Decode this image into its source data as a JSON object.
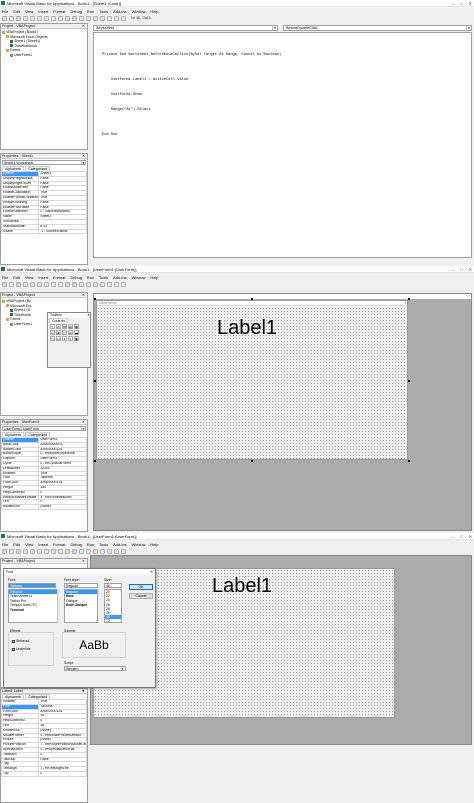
{
  "app_title": "Microsoft Visual Basic for Applications",
  "window1": {
    "title": "Microsoft Visual Basic for Applications - Book1 - [Sheet1 (Code)]",
    "menu": [
      "File",
      "Edit",
      "View",
      "Insert",
      "Format",
      "Debug",
      "Run",
      "Tools",
      "Add-Ins",
      "Window",
      "Help"
    ],
    "position": "Ln 10, Col 1",
    "project_title": "Project - VBAProject",
    "tree": [
      "VBAProject (Book1)",
      "Microsoft Excel Objects",
      "Sheet1 (Sheet1)",
      "ThisWorkbook",
      "Forms",
      "UserForm1"
    ],
    "props_title": "Properties - Sheet1",
    "props_combo": "Sheet1 Worksheet",
    "tabs": [
      "Alphabetic",
      "Categorized"
    ],
    "props": [
      [
        "(Name)",
        "Sheet1"
      ],
      [
        "DisplayPageBreaks",
        "False"
      ],
      [
        "DisplayRightToLeft",
        "False"
      ],
      [
        "EnableAutoFilter",
        "False"
      ],
      [
        "EnableCalculation",
        "True"
      ],
      [
        "EnableFormatConditionsCalculation",
        "True"
      ],
      [
        "EnableOutlining",
        "False"
      ],
      [
        "EnablePivotTable",
        "False"
      ],
      [
        "EnableSelection",
        "0 - xlNoRestrictions"
      ],
      [
        "Name",
        "Sheet1"
      ],
      [
        "ScrollArea",
        ""
      ],
      [
        "StandardWidth",
        "8.43"
      ],
      [
        "Visible",
        "-1 - xlSheetVisible"
      ]
    ],
    "object_combo": "Worksheet",
    "proc_combo": "BeforeDoubleClick",
    "code": [
      "Private Sub Worksheet_BeforeDoubleClick(ByVal Target As Range, Cancel As Boolean)",
      "",
      "    UserForm1.Label1 = ActiveCell.Value",
      "    UserForm1.Show",
      "    Range(\"A1\").Select",
      "",
      "End Sub"
    ]
  },
  "window2": {
    "title": "Microsoft Visual Basic for Applications - Book1 - [UserForm1 (UserForm)]",
    "menu": [
      "File",
      "Edit",
      "View",
      "Insert",
      "Format",
      "Debug",
      "Run",
      "Tools",
      "Add-Ins",
      "Window",
      "Help"
    ],
    "project_title": "Project - VBAProject",
    "tree": [
      "VBAProject (Bo",
      "Microsoft Exc",
      "Sheet1 (S",
      "ThisWorkb",
      "Forms",
      "UserForm1"
    ],
    "toolbox_title": "Toolbox",
    "toolbox_tab": "Controls",
    "form_caption": "UserForm1",
    "label_text": "Label1",
    "props_title": "Properties - UserForm1",
    "props_combo": "UserForm1 UserForm",
    "tabs": [
      "Alphabetic",
      "Categorized"
    ],
    "props": [
      [
        "(Name)",
        "UserForm1"
      ],
      [
        "BackColor",
        "&H8000000F&"
      ],
      [
        "BorderColor",
        "&H80000012&"
      ],
      [
        "BorderStyle",
        "0 - fmBorderStyleNone"
      ],
      [
        "Caption",
        "UserForm1"
      ],
      [
        "Cycle",
        "0 - fmCycleAllForms"
      ],
      [
        "DrawBuffer",
        "32000"
      ],
      [
        "Enabled",
        "True"
      ],
      [
        "Font",
        "Tahoma"
      ],
      [
        "ForeColor",
        "&H80000012&"
      ],
      [
        "Height",
        "180"
      ],
      [
        "HelpContextID",
        "0"
      ],
      [
        "KeepScrollBarsVisible",
        "3 - fmScrollBarsBoth"
      ],
      [
        "Left",
        "0"
      ],
      [
        "MouseIcon",
        "(None)"
      ]
    ]
  },
  "window3": {
    "title": "Microsoft Visual Basic for Applications - Book1 - [UserForm1 (UserForm)]",
    "menu": [
      "File",
      "Edit",
      "View",
      "Insert",
      "Format",
      "Debug",
      "Run",
      "Tools",
      "Add-Ins",
      "Window",
      "Help"
    ],
    "project_title": "Project - VBAProject",
    "label_text": "Label1",
    "font_dialog": {
      "title": "Font",
      "font_label": "Font:",
      "style_label": "Font style:",
      "size_label": "Size:",
      "font_value": "Tahoma",
      "style_value": "Regular",
      "size_value": "48",
      "fonts": [
        "Tahoma",
        "TeamViewer11",
        "Tekton Pro",
        "Tempus Sans ITC",
        "Terminal"
      ],
      "styles": [
        "Regular",
        "Bold",
        "Oblique",
        "Bold Oblique"
      ],
      "sizes": [
        "20",
        "22",
        "24",
        "26",
        "28",
        "36",
        "48",
        "72"
      ],
      "ok": "OK",
      "cancel": "Cancel",
      "effects_label": "Effects",
      "strikeout": "Strikeout",
      "underline": "Underline",
      "sample_label": "Sample",
      "sample_text": "AaBb",
      "script_label": "Script:",
      "script_value": "Western"
    },
    "props_head": "Label1 Label",
    "tabs": [
      "Alphabetic",
      "Categorized"
    ],
    "props": [
      [
        "Enabled",
        "True"
      ],
      [
        "Font",
        "Tahoma"
      ],
      [
        "ForeColor",
        "&H80000012&"
      ],
      [
        "Height",
        "18"
      ],
      [
        "HelpContextID",
        "0"
      ],
      [
        "Left",
        "18"
      ],
      [
        "MouseIcon",
        "(None)"
      ],
      [
        "MousePointer",
        "0 - fmMousePointerDefault"
      ],
      [
        "Picture",
        "(None)"
      ],
      [
        "PicturePosition",
        "7 - fmPicturePositionAboveCenter"
      ],
      [
        "SpecialEffect",
        "0 - fmSpecialEffectFlat"
      ],
      [
        "TabIndex",
        "0"
      ],
      [
        "TabStop",
        "False"
      ],
      [
        "Tag",
        ""
      ],
      [
        "TextAlign",
        "1 - fmTextAlignLeft"
      ],
      [
        "Top",
        "0"
      ]
    ]
  }
}
